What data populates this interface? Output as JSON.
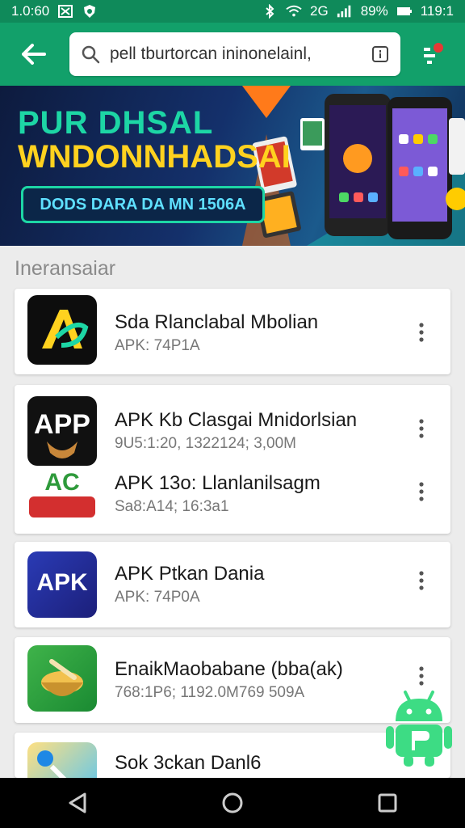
{
  "status_bar": {
    "time": "1.0:60",
    "battery": "89%",
    "clock": "119:1",
    "network": "2G"
  },
  "search": {
    "value": "pell tburtorcan ininonelainl,"
  },
  "banner": {
    "title_line1": "PUR DHSAL",
    "title_line2": "WNDONNHADSAI",
    "cta": "DODS DARA DA MN 1506A"
  },
  "section": {
    "title": "Ineransaiar"
  },
  "apps": [
    {
      "name": "Sda Rlanclabal Mbolian",
      "meta": "APK: 74P1A",
      "icon_text": ""
    },
    {
      "name": "APK Kb Clasgai Mnidorlsian",
      "meta": "9U5:1:20, 1322124; 3,00M",
      "icon_text": "APP"
    },
    {
      "name": "APK 13o: Llanlanilsagm",
      "meta": "Sa8:A14; 16:3a1",
      "icon_text": "AC"
    },
    {
      "name": "APK Ptkan Dania",
      "meta": "APK: 74P0A",
      "icon_text": "APK"
    },
    {
      "name": "EnaikMaobabane (bba(ak)",
      "meta": "768:1P6; 1192.0M769 509A",
      "icon_text": ""
    },
    {
      "name": "Sok 3ckan Danl6",
      "meta": "",
      "icon_text": ""
    }
  ],
  "colors": {
    "primary": "#12a06a",
    "status": "#0f8a5a",
    "banner_teal": "#1dd6a5",
    "banner_yellow": "#ffd21f"
  }
}
